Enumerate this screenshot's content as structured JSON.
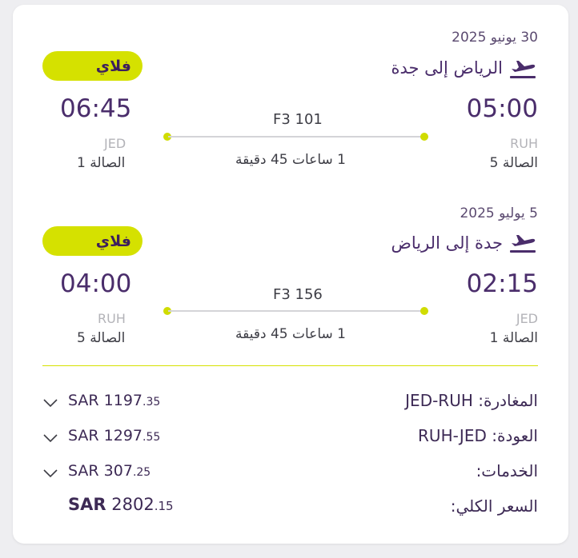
{
  "flights": [
    {
      "date": "30 يونيو 2025",
      "route": "الرياض  إلى جدة",
      "fare_badge": "فلاي",
      "depart_time": "05:00",
      "depart_code": "RUH",
      "depart_terminal": "الصالة 5",
      "arrive_time": "06:45",
      "arrive_code": "JED",
      "arrive_terminal": "الصالة 1",
      "flight_number": "F3 101",
      "duration": "1 ساعات 45 دقيقة"
    },
    {
      "date": "5 يوليو 2025",
      "route": "جدة  إلى الرياض",
      "fare_badge": "فلاي",
      "depart_time": "02:15",
      "depart_code": "JED",
      "depart_terminal": "الصالة 1",
      "arrive_time": "04:00",
      "arrive_code": "RUH",
      "arrive_terminal": "الصالة 5",
      "flight_number": "F3 156",
      "duration": "1 ساعات 45 دقيقة"
    }
  ],
  "pricing": {
    "departure": {
      "label": "المغادرة:",
      "segment": "JED-RUH",
      "currency": "SAR",
      "whole": "1197",
      "decimal": ".35"
    },
    "return": {
      "label": "العودة:",
      "segment": "RUH-JED",
      "currency": "SAR",
      "whole": "1297",
      "decimal": ".55"
    },
    "services": {
      "label": "الخدمات:",
      "currency": "SAR",
      "whole": "307",
      "decimal": ".25"
    },
    "total": {
      "label": "السعر الكلي:",
      "currency": "SAR",
      "whole": "2802",
      "decimal": ".15"
    }
  },
  "colors": {
    "accent": "#d5e100",
    "brand": "#4a2d6b"
  }
}
